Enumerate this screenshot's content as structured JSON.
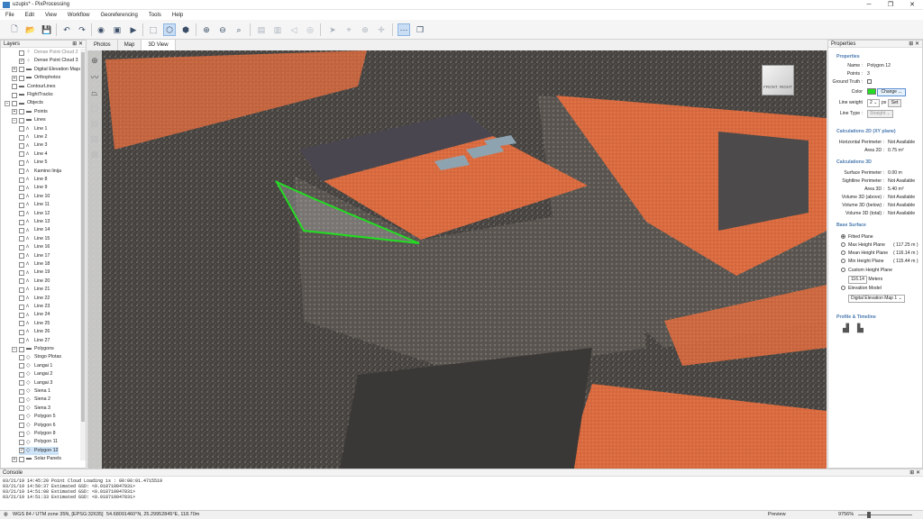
{
  "window": {
    "title": "uzupis* - PixProcessing",
    "min": "─",
    "max": "❐",
    "close": "✕"
  },
  "menu": [
    "File",
    "Edit",
    "View",
    "Workflow",
    "Georeferencing",
    "Tools",
    "Help"
  ],
  "layers_panel": {
    "title": "Layers",
    "rows": [
      {
        "label": "Dense Point Cloud 2",
        "indent": 2,
        "grey": true,
        "check": "",
        "icon": "cloud-icon"
      },
      {
        "label": "Dense Point Cloud 3",
        "indent": 2,
        "check": "✓",
        "icon": "cloud-icon"
      },
      {
        "label": "Digital Elevation Maps",
        "indent": 1,
        "exp": "+",
        "icon": "folder-icon"
      },
      {
        "label": "Orthophotos",
        "indent": 1,
        "exp": "+",
        "icon": "folder-icon"
      },
      {
        "label": "ContourLines",
        "indent": 1,
        "icon": "folder-icon"
      },
      {
        "label": "FlightTracks",
        "indent": 1,
        "icon": "folder-icon"
      },
      {
        "label": "Objects",
        "indent": 0,
        "exp": "−",
        "icon": "folder-icon"
      },
      {
        "label": "Points",
        "indent": 1,
        "exp": "+",
        "icon": "folder-icon"
      },
      {
        "label": "Lines",
        "indent": 1,
        "exp": "−",
        "icon": "folder-icon"
      },
      {
        "label": "Line 1",
        "indent": 2,
        "icon": "polyline-icon"
      },
      {
        "label": "Line 2",
        "indent": 2,
        "icon": "polyline-icon"
      },
      {
        "label": "Line 3",
        "indent": 2,
        "icon": "polyline-icon"
      },
      {
        "label": "Line 4",
        "indent": 2,
        "icon": "polyline-icon"
      },
      {
        "label": "Line 5",
        "indent": 2,
        "icon": "polyline-icon"
      },
      {
        "label": "Kamino linija",
        "indent": 2,
        "icon": "polyline-icon"
      },
      {
        "label": "Line 8",
        "indent": 2,
        "icon": "polyline-icon"
      },
      {
        "label": "Line 9",
        "indent": 2,
        "icon": "polyline-icon"
      },
      {
        "label": "Line 10",
        "indent": 2,
        "icon": "polyline-icon"
      },
      {
        "label": "Line 11",
        "indent": 2,
        "icon": "polyline-icon"
      },
      {
        "label": "Line 12",
        "indent": 2,
        "icon": "polyline-icon"
      },
      {
        "label": "Line 13",
        "indent": 2,
        "icon": "polyline-icon"
      },
      {
        "label": "Line 14",
        "indent": 2,
        "icon": "polyline-icon"
      },
      {
        "label": "Line 15",
        "indent": 2,
        "icon": "polyline-icon"
      },
      {
        "label": "Line 16",
        "indent": 2,
        "icon": "polyline-icon"
      },
      {
        "label": "Line 17",
        "indent": 2,
        "icon": "polyline-icon"
      },
      {
        "label": "Line 18",
        "indent": 2,
        "icon": "polyline-icon"
      },
      {
        "label": "Line 19",
        "indent": 2,
        "icon": "polyline-icon"
      },
      {
        "label": "Line 20",
        "indent": 2,
        "icon": "polyline-icon"
      },
      {
        "label": "Line 21",
        "indent": 2,
        "icon": "polyline-icon"
      },
      {
        "label": "Line 22",
        "indent": 2,
        "icon": "polyline-icon"
      },
      {
        "label": "Line 23",
        "indent": 2,
        "icon": "polyline-icon"
      },
      {
        "label": "Line 24",
        "indent": 2,
        "icon": "polyline-icon"
      },
      {
        "label": "Line 25",
        "indent": 2,
        "icon": "polyline-icon"
      },
      {
        "label": "Line 26",
        "indent": 2,
        "icon": "polyline-icon"
      },
      {
        "label": "Line 27",
        "indent": 2,
        "icon": "polyline-icon"
      },
      {
        "label": "Polygons",
        "indent": 1,
        "exp": "−",
        "icon": "folder-icon"
      },
      {
        "label": "Stogo Plotas",
        "indent": 2,
        "icon": "polygon-icon"
      },
      {
        "label": "Langai 1",
        "indent": 2,
        "icon": "polygon-icon"
      },
      {
        "label": "Langai 2",
        "indent": 2,
        "icon": "polygon-icon"
      },
      {
        "label": "Langai 3",
        "indent": 2,
        "icon": "polygon-icon"
      },
      {
        "label": "Siena 1",
        "indent": 2,
        "icon": "polygon-icon"
      },
      {
        "label": "Siena 2",
        "indent": 2,
        "icon": "polygon-icon"
      },
      {
        "label": "Siena 3",
        "indent": 2,
        "icon": "polygon-icon"
      },
      {
        "label": "Polygon 5",
        "indent": 2,
        "icon": "polygon-icon"
      },
      {
        "label": "Polygon 6",
        "indent": 2,
        "icon": "polygon-icon"
      },
      {
        "label": "Polygon 8",
        "indent": 2,
        "icon": "polygon-icon"
      },
      {
        "label": "Polygon 11",
        "indent": 2,
        "icon": "polygon-icon"
      },
      {
        "label": "Polygon 12",
        "indent": 2,
        "icon": "polygon-icon",
        "selected": true,
        "check": "✓"
      },
      {
        "label": "Solar Panels",
        "indent": 1,
        "exp": "+",
        "icon": "folder-icon"
      }
    ]
  },
  "view_tabs": [
    "Photos",
    "Map",
    "3D View"
  ],
  "active_tab": "3D View",
  "navcube": {
    "front": "FRONT",
    "right": "RIGHT"
  },
  "properties": {
    "title": "Properties",
    "section_properties": "Properties",
    "name_label": "Name :",
    "name_value": "Polygon 12",
    "points_label": "Points :",
    "points_value": "3",
    "ground_truth_label": "Ground Truth :",
    "color_label": "Color",
    "color_value": "#22dd22",
    "change_button": "Change ...",
    "line_weight_label": "Line weight",
    "line_weight_value": "2",
    "line_weight_unit": "px",
    "set_button": "Set",
    "line_type_label": "Line Type :",
    "line_type_value": "Straight",
    "section_calc2d": "Calculations 2D (XY plane)",
    "h_perimeter_label": "Horizontal Perimeter :",
    "h_perimeter_value": "Not Available",
    "area2d_label": "Area 2D :",
    "area2d_value": "0.75 m²",
    "section_calc3d": "Calculations 3D",
    "surface_perimeter_label": "Surface Perimeter :",
    "surface_perimeter_value": "0.00 m",
    "skyline_perimeter_label": "Sightline Perimeter :",
    "skyline_perimeter_value": "Not Available",
    "area3d_label": "Area 3D :",
    "area3d_value": "5.40 m²",
    "vol_above_label": "Volume 3D (above) :",
    "vol_above_value": "Not Available",
    "vol_below_label": "Volume 3D (below) :",
    "vol_below_value": "Not Available",
    "vol_total_label": "Volume 3D (total) :",
    "vol_total_value": "Not Available",
    "section_base": "Base Surface",
    "fitted_plane": "Fitted Plane",
    "max_height_plane": "Max Height Plane",
    "max_height_value": "( 117.25 m )",
    "mean_height_plane": "Mean Height Plane",
    "mean_height_value": "( 116.14 m )",
    "min_height_plane": "Min Height Plane",
    "min_height_value": "( 115.44 m )",
    "custom_height_plane": "Custom Height Plane",
    "custom_height_value": "116.14",
    "custom_height_unit": "Meters",
    "elevation_model": "Elevation Model",
    "elevation_model_value": "Digital Elevation Map 1",
    "section_profile": "Profile & Timeline"
  },
  "console": {
    "title": "Console",
    "lines": [
      "03/21/19 14:45:20  Point Cloud Loading is : 00:00:01.4715519",
      "03/21/19 14:50:37  Estimated GSD: <0.018710047831>",
      "03/21/19 14:51:08  Estimated GSD: <0.018710047831>",
      "03/21/19 14:51:33  Estimated GSD: <0.018710047831>"
    ]
  },
  "status": {
    "crs": "WGS 84 / UTM zone 35N, [EPSG:32635]",
    "coords": "54.68091460°N, 25.29952845°E, 118.70m",
    "preview": "Preview",
    "zoom": "9756%"
  }
}
